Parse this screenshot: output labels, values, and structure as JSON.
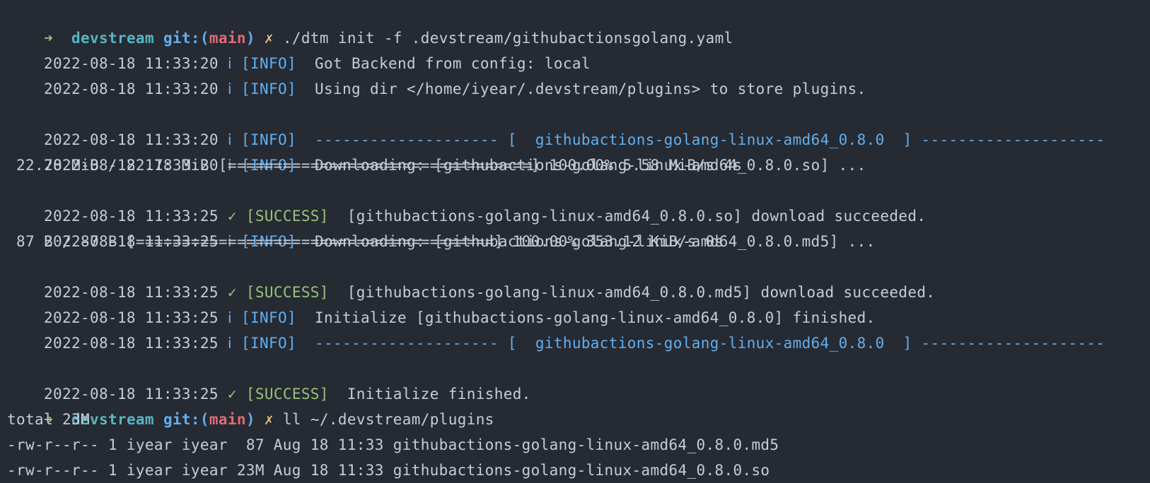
{
  "window": {
    "background": "#262a33"
  },
  "colors": {
    "text": "#c8ccd4",
    "prompt_arrow": "#98c379",
    "prompt_dir": "#56b6c2",
    "prompt_git": "#61afef",
    "prompt_branch": "#e06c75",
    "prompt_dirty": "#e5c07b",
    "info": "#61afef",
    "success": "#98c379"
  },
  "icons": {
    "prompt_arrow": "arrow-right-icon",
    "dirty": "x-mark-icon",
    "info": "info-icon",
    "success": "check-icon"
  },
  "lines": {
    "l0": {
      "arrow": "➜",
      "dir": "devstream",
      "git": "git:(",
      "branch": "main",
      "git_close": ")",
      "dirty": "✗",
      "command": "./dtm init -f .devstream/githubactionsgolang.yaml"
    },
    "l1": {
      "ts": "2022-08-18 11:33:20",
      "icon": "ⅰ",
      "tag": "[INFO]",
      "msg": "Got Backend from config: local"
    },
    "l2": {
      "ts": "2022-08-18 11:33:20",
      "icon": "ⅰ",
      "tag": "[INFO]",
      "msg": "Using dir </home/iyear/.devstream/plugins> to store plugins."
    },
    "l3": {
      "text": ""
    },
    "l4": {
      "ts": "2022-08-18 11:33:20",
      "icon": "ⅰ",
      "tag": "[INFO]",
      "msg": "-------------------- [  githubactions-golang-linux-amd64_0.8.0  ] --------------------"
    },
    "l5": {
      "ts": "2022-08-18 11:33:20",
      "icon": "ⅰ",
      "tag": "[INFO]",
      "msg": "Downloading: [githubactions-golang-linux-amd64_0.8.0.so] ..."
    },
    "l6": {
      "text": " 22.78 MiB / 22.78 MiB [=================================] 100.00% 5.58 MiB/s 4s"
    },
    "l7": {
      "ts": "2022-08-18 11:33:25",
      "icon": "✓",
      "tag": "[SUCCESS]",
      "msg": "[githubactions-golang-linux-amd64_0.8.0.so] download succeeded."
    },
    "l8": {
      "ts": "2022-08-18 11:33:25",
      "icon": "ⅰ",
      "tag": "[INFO]",
      "msg": "Downloading: [githubactions-golang-linux-amd64_0.8.0.md5] ..."
    },
    "l9": {
      "text": " 87 B / 87 B [=======================================] 100.00% 353.12 KiB/s 0s"
    },
    "l10": {
      "ts": "2022-08-18 11:33:25",
      "icon": "✓",
      "tag": "[SUCCESS]",
      "msg": "[githubactions-golang-linux-amd64_0.8.0.md5] download succeeded."
    },
    "l11": {
      "ts": "2022-08-18 11:33:25",
      "icon": "ⅰ",
      "tag": "[INFO]",
      "msg": "Initialize [githubactions-golang-linux-amd64_0.8.0] finished."
    },
    "l12": {
      "ts": "2022-08-18 11:33:25",
      "icon": "ⅰ",
      "tag": "[INFO]",
      "msg": "-------------------- [  githubactions-golang-linux-amd64_0.8.0  ] --------------------"
    },
    "l13": {
      "text": ""
    },
    "l14": {
      "ts": "2022-08-18 11:33:25",
      "icon": "✓",
      "tag": "[SUCCESS]",
      "msg": "Initialize finished."
    },
    "l15": {
      "arrow": "➜",
      "dir": "devstream",
      "git": "git:(",
      "branch": "main",
      "git_close": ")",
      "dirty": "✗",
      "command": "ll ~/.devstream/plugins"
    },
    "l16": {
      "text": "total 23M"
    },
    "l17": {
      "text": "-rw-r--r-- 1 iyear iyear  87 Aug 18 11:33 githubactions-golang-linux-amd64_0.8.0.md5"
    },
    "l18": {
      "text": "-rw-r--r-- 1 iyear iyear 23M Aug 18 11:33 githubactions-golang-linux-amd64_0.8.0.so"
    }
  }
}
